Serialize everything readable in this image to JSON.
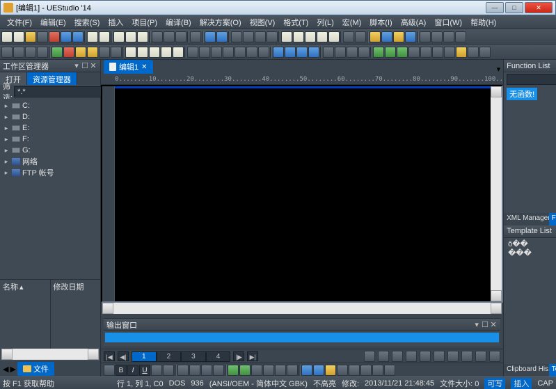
{
  "window": {
    "title": "[编辑1] - UEStudio '14"
  },
  "menu": {
    "items": [
      "文件(F)",
      "编辑(E)",
      "搜索(S)",
      "插入",
      "项目(P)",
      "编译(B)",
      "解决方案(O)",
      "视图(V)",
      "格式(T)",
      "列(L)",
      "宏(M)",
      "脚本(I)",
      "高级(A)",
      "窗口(W)",
      "帮助(H)"
    ]
  },
  "leftPanel": {
    "title": "工作区管理器",
    "tabs": {
      "open": "打开",
      "explorer": "资源管理器"
    },
    "filter": {
      "label": "筛选:",
      "value": "*.*",
      "goIcon": ">",
      "settingsIcon": "⚙"
    },
    "tree": {
      "drives": [
        "C:",
        "D:",
        "E:",
        "F:",
        "G:"
      ],
      "network": "网络",
      "ftp": "FTP 帐号"
    },
    "lower": {
      "name": "名称",
      "date": "修改日期"
    },
    "filesBtn": "文件"
  },
  "doc": {
    "tab": {
      "name": "编辑1"
    },
    "ruler": "0........10........20........30........40........50........60........70........80........90.......100.."
  },
  "output": {
    "title": "输出窗口"
  },
  "pages": {
    "nav": {
      "first": "|◀",
      "prev": "◀|",
      "next": "|▶",
      "last": "▶|"
    },
    "items": [
      "1",
      "2",
      "3",
      "4"
    ]
  },
  "fmt": {
    "bold": "B",
    "italic": "I",
    "underline": "U"
  },
  "fnList": {
    "title": "Function List",
    "msg": "无函数!",
    "tabs": {
      "xml": "XML Manager",
      "fn": "Function List"
    }
  },
  "tmpl": {
    "title": "Template List",
    "items": [
      "ô��",
      "���"
    ],
    "tabs": {
      "clip": "Clipboard His...",
      "tmpl": "Template List"
    }
  },
  "status": {
    "help": "按 F1 获取帮助",
    "pos": "行 1, 列 1, C0",
    "eol": "DOS",
    "cp": "936",
    "enc": "(ANSI/OEM - 简体中文 GBK)",
    "hl": "不高亮",
    "mod": "修改:",
    "time": "2013/11/21 21:48:45",
    "size": "文件大小: 0",
    "ro": "可写",
    "ins": "插入",
    "cap": "CAP"
  }
}
